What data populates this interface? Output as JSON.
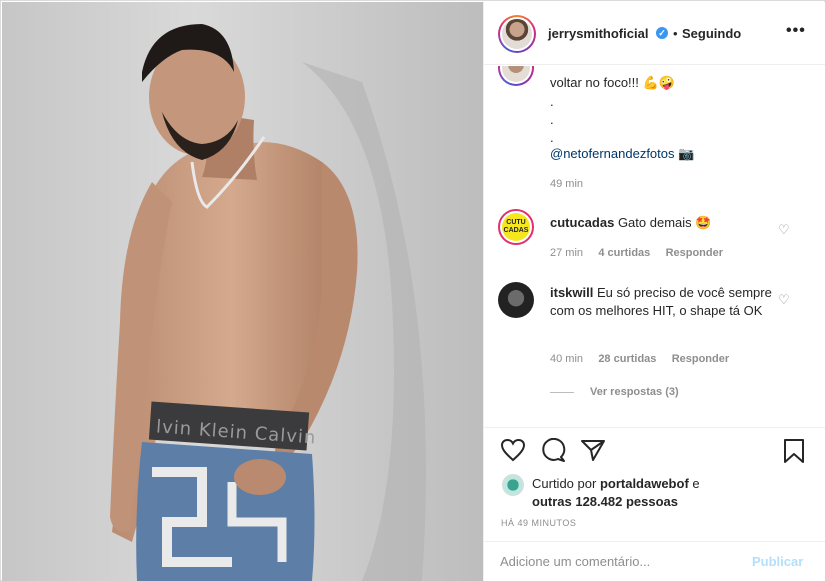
{
  "header": {
    "username": "jerrysmithoficial",
    "verified_mark": "✓",
    "separator": "•",
    "follow_status": "Seguindo",
    "more_label": "•••"
  },
  "caption": {
    "line1": "voltar no foco!!! 💪🤪",
    "dot1": ".",
    "dot2": ".",
    "dot3": ".",
    "mention": "@netofernandezfotos",
    "camera_emoji": "📷",
    "time": "49 min"
  },
  "comments": [
    {
      "username": "cutucadas",
      "avatar_text": "CUTU CADAS",
      "text": "Gato demais 🤩",
      "time": "27 min",
      "likes": "4 curtidas",
      "reply": "Responder"
    },
    {
      "username": "itskwill",
      "text": "Eu só preciso de você sempre com os melhores HIT, o shape tá OK",
      "time": "40 min",
      "likes": "28 curtidas",
      "reply": "Responder",
      "view_replies": "Ver respostas (3)"
    }
  ],
  "likes": {
    "prefix": "Curtido por",
    "user": "portaldawebof",
    "mid": "e",
    "others": "outras 128.482 pessoas"
  },
  "timestamp": "HÁ 49 MINUTOS",
  "comment_box": {
    "placeholder": "Adicione um comentário...",
    "publish": "Publicar"
  },
  "photo": {
    "waistband_text": "lvin Klein   Calvin"
  },
  "colors": {
    "link": "#00376b",
    "verified": "#3897f0",
    "publish_disabled": "#b2dffc"
  },
  "icons": [
    "heart-icon",
    "comment-icon",
    "share-icon",
    "bookmark-icon",
    "more-icon"
  ]
}
